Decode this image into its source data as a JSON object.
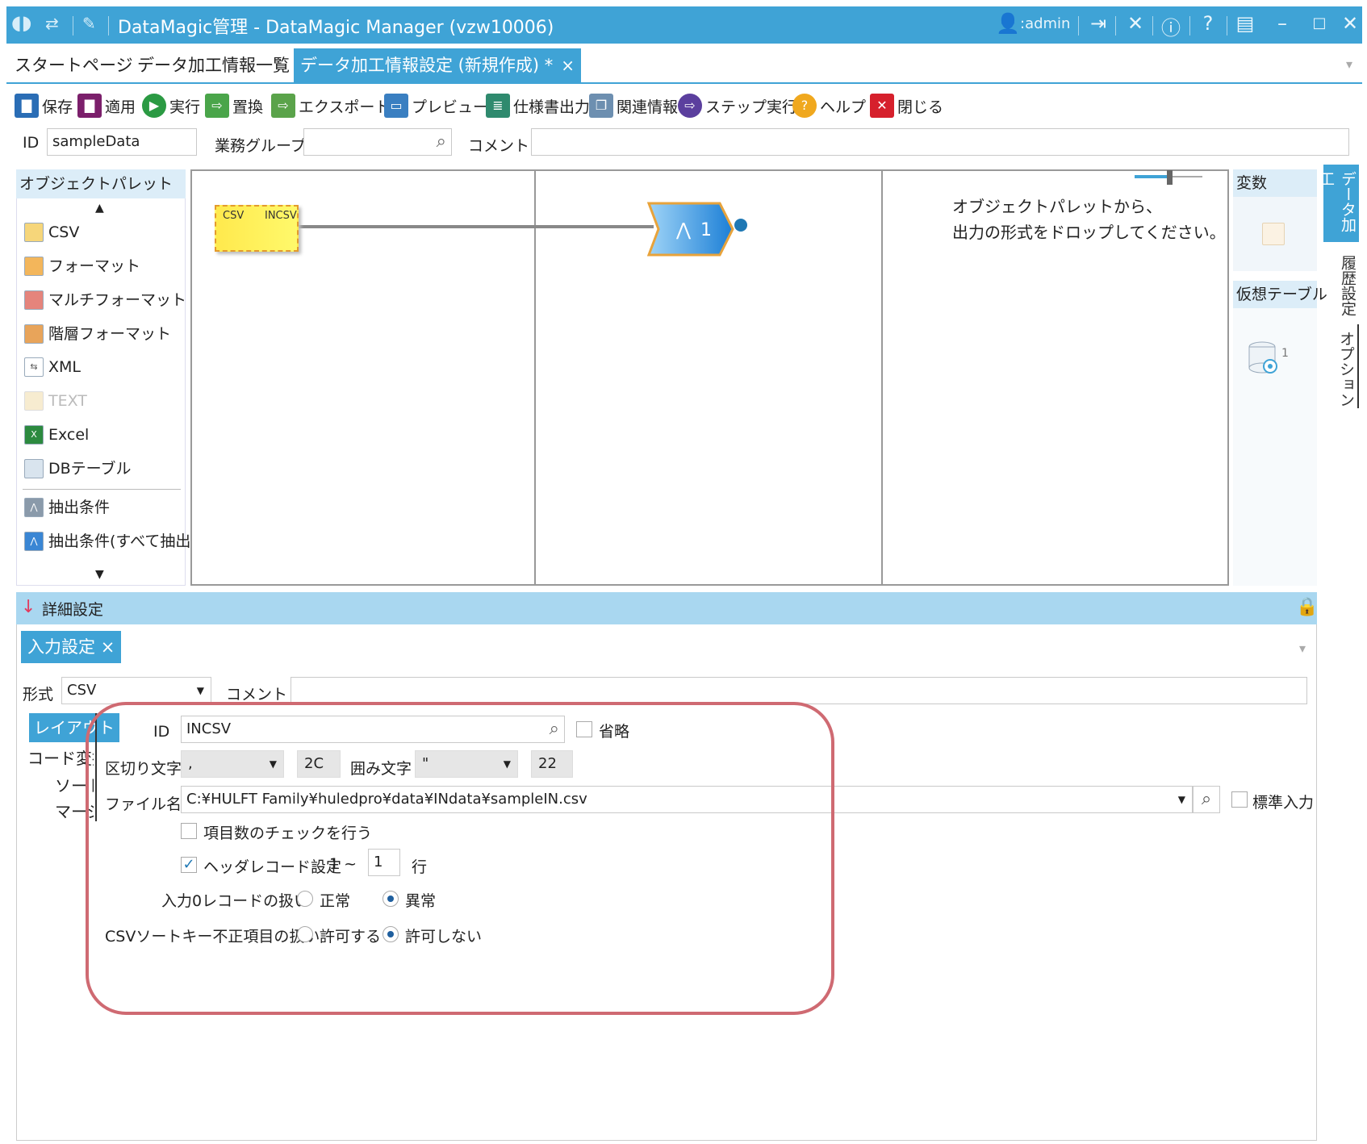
{
  "window": {
    "title": "DataMagic管理 - DataMagic Manager (vzw10006)",
    "user": ":admin"
  },
  "tabs": [
    {
      "label": "スタートページ"
    },
    {
      "label": "データ加工情報一覧"
    },
    {
      "label": "データ加工情報設定 (新規作成) *",
      "close": "×"
    }
  ],
  "toolbar": {
    "save": "保存",
    "apply": "適用",
    "run": "実行",
    "replace": "置換",
    "export": "エクスポート",
    "preview": "プレビュー",
    "spec_output": "仕様書出力",
    "related_info": "関連情報",
    "step_run": "ステップ実行",
    "help": "ヘルプ",
    "close": "閉じる"
  },
  "info_row": {
    "id_label": "ID",
    "id_value": "sampleData",
    "group_label": "業務グループ",
    "group_value": "",
    "comment_label": "コメント",
    "comment_value": ""
  },
  "palette": {
    "title": "オブジェクトパレット",
    "items": [
      "CSV",
      "フォーマット",
      "マルチフォーマット",
      "階層フォーマット",
      "XML",
      "TEXT",
      "Excel",
      "DBテーブル"
    ],
    "conditions": [
      "抽出条件",
      "抽出条件(すべて抽出)"
    ]
  },
  "canvas": {
    "csv_node_type": "CSV",
    "csv_node_id": "INCSV",
    "extract_node_count": "1",
    "drop_message_line1": "オブジェクトパレットから、",
    "drop_message_line2": "出力の形式をドロップしてください。"
  },
  "side_panel": {
    "variables_title": "変数",
    "virtual_table_title": "仮想テーブル",
    "virtual_table_count": "1"
  },
  "vertical_tabs": [
    "データ加工",
    "履歴設定",
    "オプション"
  ],
  "detail": {
    "title": "詳細設定",
    "subtab": "入力設定",
    "subtab_close": "×",
    "format_label": "形式",
    "format_value": "CSV",
    "comment_label": "コメント",
    "comment_value": "",
    "side_items": [
      "レイアウト",
      "コード変換",
      "ソート",
      "マージ"
    ],
    "side_items_visible": [
      "レイアウト",
      "コード変換",
      "ソート",
      "マージ"
    ],
    "id_label": "ID",
    "id_value": "INCSV",
    "omit_label": "省略",
    "delimiter_label": "区切り文字",
    "delimiter_value": ",",
    "delimiter_hex": "2C",
    "quote_label": "囲み文字",
    "quote_value": "\"",
    "quote_hex": "22",
    "filename_label": "ファイル名",
    "filename_value": "C:¥HULFT Family¥huledpro¥data¥INdata¥sampleIN.csv",
    "stdin_label": "標準入力",
    "check_count_label": "項目数のチェックを行う",
    "header_label": "ヘッダレコード設定",
    "header_from": "1 ~",
    "header_to": "1",
    "header_unit": "行",
    "zero_record_label": "入力0レコードの扱い",
    "zero_normal": "正常",
    "zero_error": "異常",
    "sortkey_label": "CSVソートキー不正項目の扱い",
    "sortkey_allow": "許可する",
    "sortkey_deny": "許可しない"
  }
}
